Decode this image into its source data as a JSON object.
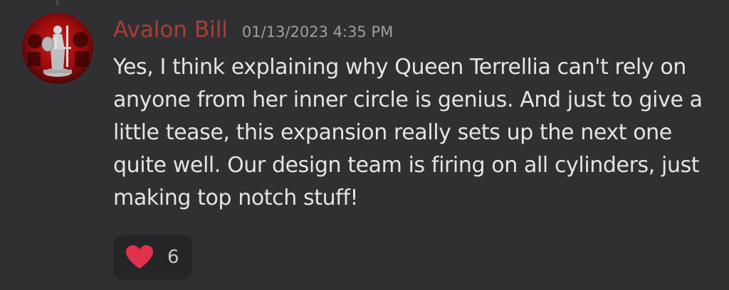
{
  "message": {
    "author": "Avalon Bill",
    "timestamp": "01/13/2023 4:35 PM",
    "text": "Yes, I think explaining why Queen Terrellia can't rely on anyone from her inner circle is genius. And just to give a little tease, this expansion really sets up the next one quite well. Our design team is firing on all cylinders, just making top notch stuff!",
    "avatar_icon": "miniature-figure-avatar",
    "reaction": {
      "emoji": "heart-icon",
      "count": "6"
    }
  },
  "colors": {
    "background": "#303033",
    "username": "#a73f35",
    "timestamp": "#9e9fa6",
    "text": "#e3e4e8",
    "reaction_bg": "#252528",
    "heart": "#e0314d"
  }
}
